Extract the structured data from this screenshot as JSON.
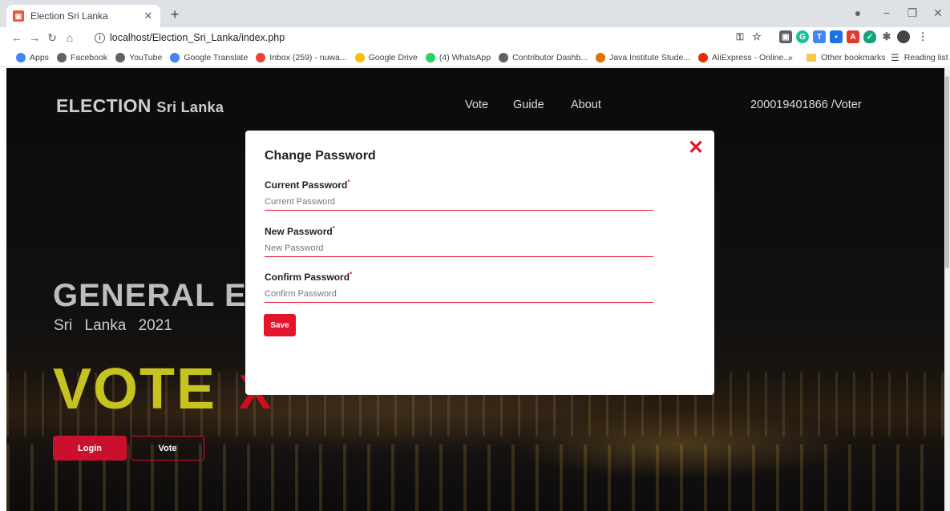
{
  "browser": {
    "tab_title": "Election Sri Lanka",
    "tab_favicon": "election-favicon",
    "url": "localhost/Election_Sri_Lanka/index.php",
    "bookmarks": [
      {
        "label": "Apps",
        "icon": "apps-grid-icon",
        "color": "#4285f4"
      },
      {
        "label": "Facebook",
        "icon": "globe-icon",
        "color": "#5f6368"
      },
      {
        "label": "YouTube",
        "icon": "globe-icon",
        "color": "#5f6368"
      },
      {
        "label": "Google Translate",
        "icon": "translate-icon",
        "color": "#4285f4"
      },
      {
        "label": "Inbox (259) - nuwa...",
        "icon": "gmail-icon",
        "color": "#ea4335"
      },
      {
        "label": "Google Drive",
        "icon": "drive-icon",
        "color": "#fbbc04"
      },
      {
        "label": "(4) WhatsApp",
        "icon": "whatsapp-icon",
        "color": "#25d366"
      },
      {
        "label": "Contributor Dashb...",
        "icon": "globe-icon",
        "color": "#5f6368"
      },
      {
        "label": "Java Institute Stude...",
        "icon": "java-icon",
        "color": "#e76f00"
      },
      {
        "label": "AliExpress - Online...",
        "icon": "aliexpress-icon",
        "color": "#e62e04"
      }
    ],
    "more_bookmarks": "»",
    "other_bookmarks": "Other bookmarks",
    "reading_list": "Reading list"
  },
  "site": {
    "brand_main": "ELECTION",
    "brand_sub": "Sri Lanka",
    "nav": [
      "Vote",
      "Guide",
      "About"
    ],
    "user": "200019401866 /Voter",
    "hero_title": "GENERAL ELI",
    "hero_country": "Sri Lanka",
    "hero_year": "2021",
    "hero_vote": "VOTE",
    "hero_x": "X",
    "login_button": "Login",
    "vote_button": "Vote"
  },
  "modal": {
    "title": "Change Password",
    "close": "✕",
    "fields": [
      {
        "label": "Current Password",
        "required": "*",
        "placeholder": "Current Password"
      },
      {
        "label": "New Password",
        "required": "*",
        "placeholder": "New Password"
      },
      {
        "label": "Confirm Password",
        "required": "*",
        "placeholder": "Confirm Password"
      }
    ],
    "save_label": "Save"
  },
  "colors": {
    "accent": "#e3142c",
    "hero_yellow": "#c6c21f"
  }
}
